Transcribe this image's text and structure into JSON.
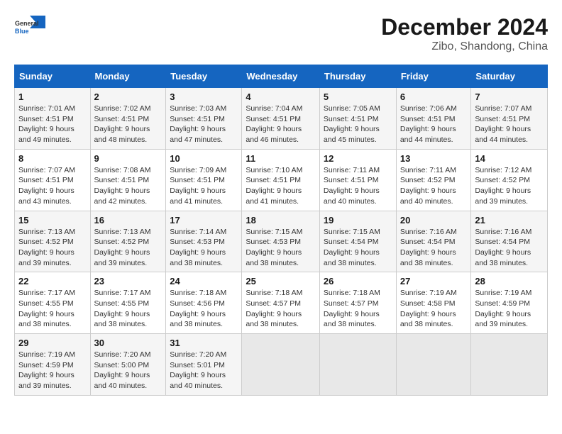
{
  "header": {
    "logo_general": "General",
    "logo_blue": "Blue",
    "title": "December 2024",
    "subtitle": "Zibo, Shandong, China"
  },
  "calendar": {
    "days_of_week": [
      "Sunday",
      "Monday",
      "Tuesday",
      "Wednesday",
      "Thursday",
      "Friday",
      "Saturday"
    ],
    "weeks": [
      [
        {
          "day": "1",
          "sunrise": "7:01 AM",
          "sunset": "4:51 PM",
          "daylight": "9 hours and 49 minutes."
        },
        {
          "day": "2",
          "sunrise": "7:02 AM",
          "sunset": "4:51 PM",
          "daylight": "9 hours and 48 minutes."
        },
        {
          "day": "3",
          "sunrise": "7:03 AM",
          "sunset": "4:51 PM",
          "daylight": "9 hours and 47 minutes."
        },
        {
          "day": "4",
          "sunrise": "7:04 AM",
          "sunset": "4:51 PM",
          "daylight": "9 hours and 46 minutes."
        },
        {
          "day": "5",
          "sunrise": "7:05 AM",
          "sunset": "4:51 PM",
          "daylight": "9 hours and 45 minutes."
        },
        {
          "day": "6",
          "sunrise": "7:06 AM",
          "sunset": "4:51 PM",
          "daylight": "9 hours and 44 minutes."
        },
        {
          "day": "7",
          "sunrise": "7:07 AM",
          "sunset": "4:51 PM",
          "daylight": "9 hours and 44 minutes."
        }
      ],
      [
        {
          "day": "8",
          "sunrise": "7:07 AM",
          "sunset": "4:51 PM",
          "daylight": "9 hours and 43 minutes."
        },
        {
          "day": "9",
          "sunrise": "7:08 AM",
          "sunset": "4:51 PM",
          "daylight": "9 hours and 42 minutes."
        },
        {
          "day": "10",
          "sunrise": "7:09 AM",
          "sunset": "4:51 PM",
          "daylight": "9 hours and 41 minutes."
        },
        {
          "day": "11",
          "sunrise": "7:10 AM",
          "sunset": "4:51 PM",
          "daylight": "9 hours and 41 minutes."
        },
        {
          "day": "12",
          "sunrise": "7:11 AM",
          "sunset": "4:51 PM",
          "daylight": "9 hours and 40 minutes."
        },
        {
          "day": "13",
          "sunrise": "7:11 AM",
          "sunset": "4:52 PM",
          "daylight": "9 hours and 40 minutes."
        },
        {
          "day": "14",
          "sunrise": "7:12 AM",
          "sunset": "4:52 PM",
          "daylight": "9 hours and 39 minutes."
        }
      ],
      [
        {
          "day": "15",
          "sunrise": "7:13 AM",
          "sunset": "4:52 PM",
          "daylight": "9 hours and 39 minutes."
        },
        {
          "day": "16",
          "sunrise": "7:13 AM",
          "sunset": "4:52 PM",
          "daylight": "9 hours and 39 minutes."
        },
        {
          "day": "17",
          "sunrise": "7:14 AM",
          "sunset": "4:53 PM",
          "daylight": "9 hours and 38 minutes."
        },
        {
          "day": "18",
          "sunrise": "7:15 AM",
          "sunset": "4:53 PM",
          "daylight": "9 hours and 38 minutes."
        },
        {
          "day": "19",
          "sunrise": "7:15 AM",
          "sunset": "4:54 PM",
          "daylight": "9 hours and 38 minutes."
        },
        {
          "day": "20",
          "sunrise": "7:16 AM",
          "sunset": "4:54 PM",
          "daylight": "9 hours and 38 minutes."
        },
        {
          "day": "21",
          "sunrise": "7:16 AM",
          "sunset": "4:54 PM",
          "daylight": "9 hours and 38 minutes."
        }
      ],
      [
        {
          "day": "22",
          "sunrise": "7:17 AM",
          "sunset": "4:55 PM",
          "daylight": "9 hours and 38 minutes."
        },
        {
          "day": "23",
          "sunrise": "7:17 AM",
          "sunset": "4:55 PM",
          "daylight": "9 hours and 38 minutes."
        },
        {
          "day": "24",
          "sunrise": "7:18 AM",
          "sunset": "4:56 PM",
          "daylight": "9 hours and 38 minutes."
        },
        {
          "day": "25",
          "sunrise": "7:18 AM",
          "sunset": "4:57 PM",
          "daylight": "9 hours and 38 minutes."
        },
        {
          "day": "26",
          "sunrise": "7:18 AM",
          "sunset": "4:57 PM",
          "daylight": "9 hours and 38 minutes."
        },
        {
          "day": "27",
          "sunrise": "7:19 AM",
          "sunset": "4:58 PM",
          "daylight": "9 hours and 38 minutes."
        },
        {
          "day": "28",
          "sunrise": "7:19 AM",
          "sunset": "4:59 PM",
          "daylight": "9 hours and 39 minutes."
        }
      ],
      [
        {
          "day": "29",
          "sunrise": "7:19 AM",
          "sunset": "4:59 PM",
          "daylight": "9 hours and 39 minutes."
        },
        {
          "day": "30",
          "sunrise": "7:20 AM",
          "sunset": "5:00 PM",
          "daylight": "9 hours and 40 minutes."
        },
        {
          "day": "31",
          "sunrise": "7:20 AM",
          "sunset": "5:01 PM",
          "daylight": "9 hours and 40 minutes."
        },
        null,
        null,
        null,
        null
      ]
    ]
  }
}
